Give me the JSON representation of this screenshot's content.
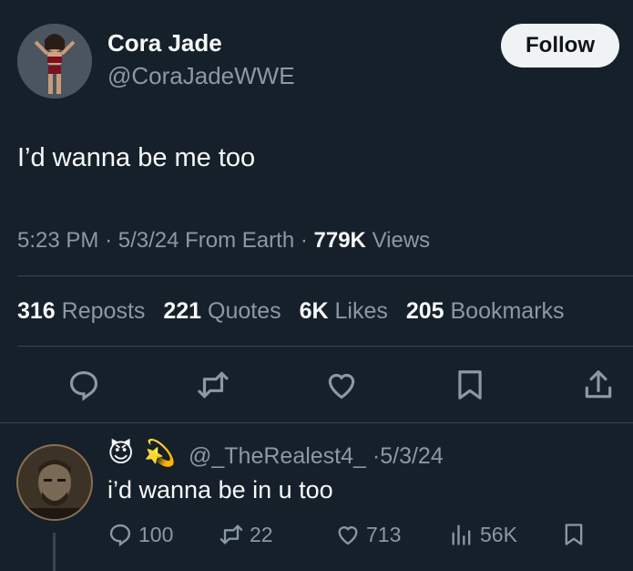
{
  "author": {
    "name": "Cora Jade",
    "handle": "@CoraJadeWWE",
    "avatar_icon": "profile-photo"
  },
  "follow_label": "Follow",
  "tweet": {
    "text": "I’d wanna be me too",
    "time": "5:23 PM",
    "date": "5/3/24",
    "source": "From Earth",
    "views_count": "779K",
    "views_label": "Views"
  },
  "stats": {
    "reposts": {
      "count": "316",
      "label": "Reposts"
    },
    "quotes": {
      "count": "221",
      "label": "Quotes"
    },
    "likes": {
      "count": "6K",
      "label": "Likes"
    },
    "bookmarks": {
      "count": "205",
      "label": "Bookmarks"
    }
  },
  "actions": [
    "reply-icon",
    "repost-icon",
    "like-icon",
    "bookmark-icon",
    "share-icon"
  ],
  "reply": {
    "emoji1": "😈",
    "emoji2": "💫",
    "handle": "@_TheRealest4_",
    "separator": "·",
    "date": "5/3/24",
    "text": "i’d wanna be in u too",
    "replies": "100",
    "reposts": "22",
    "likes": "713",
    "views": "56K"
  },
  "colors": {
    "background": "#15202b",
    "text_primary": "#f7f9f9",
    "text_secondary": "#8b98a5",
    "divider": "#38444d",
    "follow_bg": "#eff3f4"
  }
}
